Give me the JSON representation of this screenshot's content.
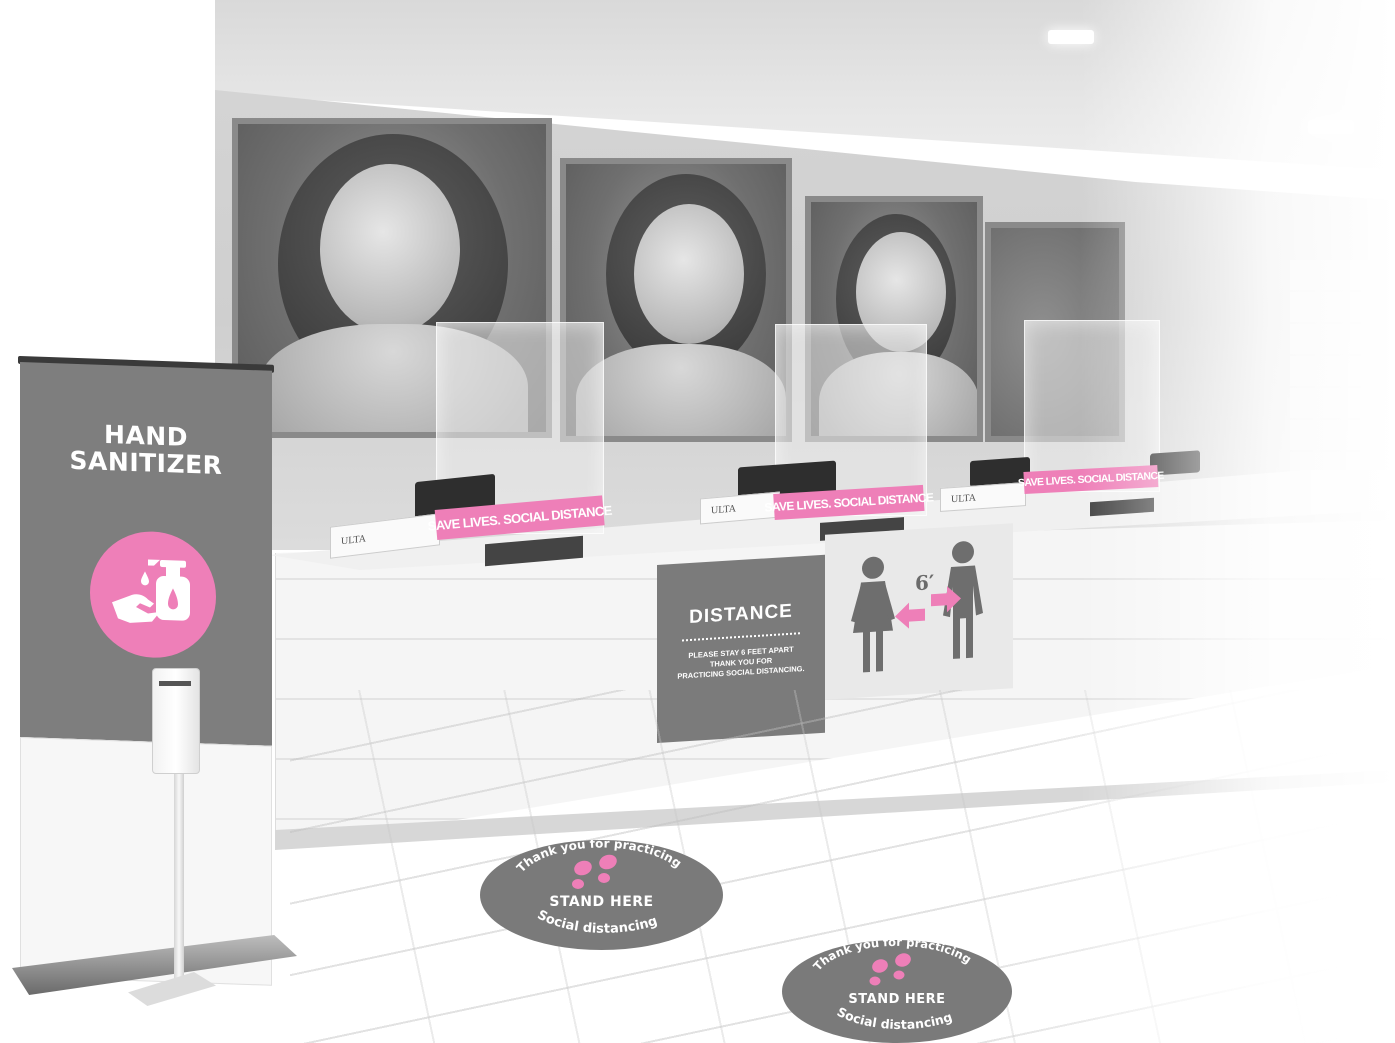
{
  "scene": {
    "banner": {
      "title_line1": "HAND",
      "title_line2": "SANITIZER",
      "icon": "hand-sanitizer-icon",
      "accent_color": "#ee7fb8",
      "panel_color": "#7e7e7e"
    },
    "shield_signs": [
      "SAVE LIVES. SOCIAL DISTANCE",
      "SAVE LIVES. SOCIAL DISTANCE",
      "SAVE LIVES. SOCIAL DISTANCE"
    ],
    "counter_cards": [
      "ULTA",
      "ULTA",
      "ULTA"
    ],
    "distance_sign": {
      "title": "DISTANCE",
      "line1": "PLEASE STAY 6 FEET APART",
      "line2": "THANK YOU FOR",
      "line3": "PRACTICING SOCIAL DISTANCING.",
      "gap_label": "6′",
      "icon": "people-distance-icon"
    },
    "floor_decals": [
      {
        "top_text": "Thank you for practicing",
        "center_text": "STAND HERE",
        "bottom_text": "Social distancing",
        "icon": "footprints-icon"
      },
      {
        "top_text": "Thank you for practicing",
        "center_text": "STAND HERE",
        "bottom_text": "Social distancing",
        "icon": "footprints-icon"
      }
    ]
  }
}
